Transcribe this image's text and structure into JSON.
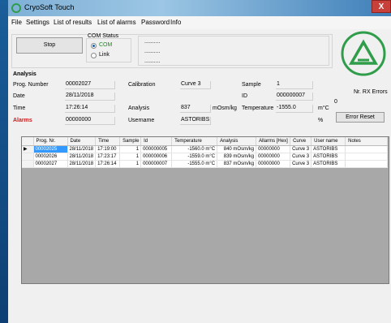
{
  "window": {
    "title": "CryoSoft Touch",
    "close": "X"
  },
  "menu": [
    "File",
    "Settings",
    "List of results",
    "List of alarms",
    "Password",
    "Info"
  ],
  "controls": {
    "stop_label": "Stop",
    "com_status_label": "COM Status",
    "com_option": "COM",
    "link_option": "Link",
    "placeholders": [
      "..........",
      "..........",
      ".........."
    ]
  },
  "analysis": {
    "heading": "Analysis",
    "labels": {
      "prog": "Prog. Number",
      "date": "Date",
      "time": "Time",
      "alarms": "Alarms",
      "calibration": "Calibration",
      "analysis": "Analysis",
      "username": "Username",
      "sample": "Sample",
      "id": "ID",
      "temperature": "Temperature"
    },
    "values": {
      "prog": "00002027",
      "date": "28/11/2018",
      "time": "17:26:14",
      "alarms": "00000000",
      "calibration": "Curve 3",
      "analysis": "837",
      "analysis_unit": "mOsm/kg",
      "username": "ASTORIBS",
      "sample": "1",
      "id": "000000007",
      "temperature": "-1555.0",
      "temperature_unit": "m°C",
      "percent_unit": "%"
    }
  },
  "rx": {
    "label": "Nr. RX Errors",
    "value": "0",
    "reset_label": "Error Reset"
  },
  "table": {
    "headers": [
      "Prog. Nr.",
      "Date",
      "Time",
      "Sample",
      "Id",
      "Temperature",
      "Analysis",
      "Allarms [Hex]",
      "Curve",
      "User name",
      "Notes"
    ],
    "rows": [
      [
        "00002025",
        "28/11/2018",
        "17:19:00",
        "1",
        "000000005",
        "-1560.0 m°C",
        "840 mOsm/kg",
        "00000000",
        "Curve 3",
        "ASTORIBS",
        ""
      ],
      [
        "00002026",
        "28/11/2018",
        "17:23:17",
        "1",
        "000000006",
        "-1559.0 m°C",
        "839 mOsm/kg",
        "00000000",
        "Curve 3",
        "ASTORIBS",
        ""
      ],
      [
        "00002027",
        "28/11/2018",
        "17:26:14",
        "1",
        "000000007",
        "-1555.0 m°C",
        "837 mOsm/kg",
        "00000000",
        "Curve 3",
        "ASTORIBS",
        ""
      ]
    ]
  },
  "colors": {
    "alarm": "#cc1a1a",
    "com": "#1e8a1e",
    "logo": "#2f9d4a",
    "selection": "#3399ff"
  }
}
